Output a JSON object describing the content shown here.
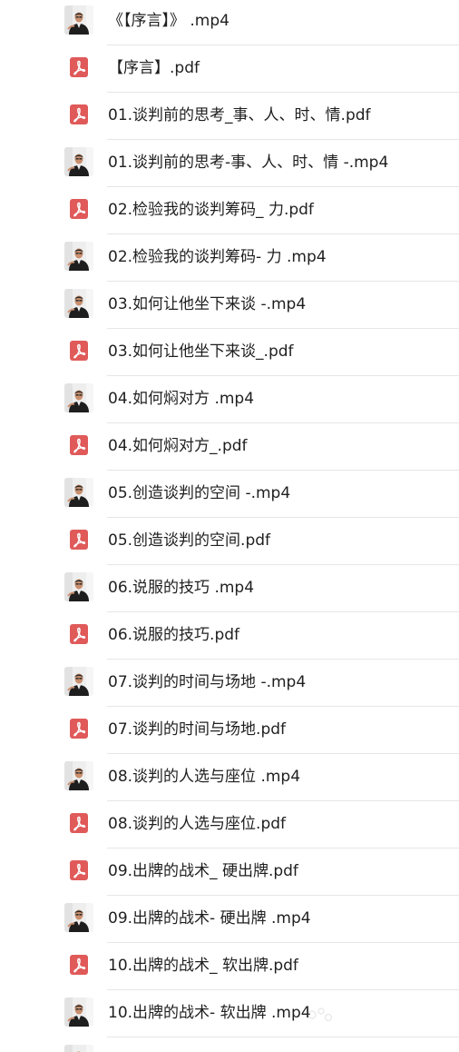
{
  "files": [
    {
      "name": "《【序言】》 .mp4",
      "type": "video",
      "icon": "video-thumbnail-icon"
    },
    {
      "name": "【序言】.pdf",
      "type": "pdf",
      "icon": "pdf-icon"
    },
    {
      "name": "01.谈判前的思考_事、人、时、情.pdf",
      "type": "pdf",
      "icon": "pdf-icon"
    },
    {
      "name": "01.谈判前的思考-事、人、时、情 -.mp4",
      "type": "video",
      "icon": "video-thumbnail-icon"
    },
    {
      "name": "02.检验我的谈判筹码_ 力.pdf",
      "type": "pdf",
      "icon": "pdf-icon"
    },
    {
      "name": "02.检验我的谈判筹码- 力 .mp4",
      "type": "video",
      "icon": "video-thumbnail-icon"
    },
    {
      "name": "03.如何让他坐下来谈 -.mp4",
      "type": "video",
      "icon": "video-thumbnail-icon"
    },
    {
      "name": "03.如何让他坐下来谈_.pdf",
      "type": "pdf",
      "icon": "pdf-icon"
    },
    {
      "name": "04.如何焖对方 .mp4",
      "type": "video",
      "icon": "video-thumbnail-icon"
    },
    {
      "name": "04.如何焖对方_.pdf",
      "type": "pdf",
      "icon": "pdf-icon"
    },
    {
      "name": "05.创造谈判的空间 -.mp4",
      "type": "video",
      "icon": "video-thumbnail-icon"
    },
    {
      "name": "05.创造谈判的空间.pdf",
      "type": "pdf",
      "icon": "pdf-icon"
    },
    {
      "name": "06.说服的技巧 .mp4",
      "type": "video",
      "icon": "video-thumbnail-icon"
    },
    {
      "name": "06.说服的技巧.pdf",
      "type": "pdf",
      "icon": "pdf-icon"
    },
    {
      "name": "07.谈判的时间与场地 -.mp4",
      "type": "video",
      "icon": "video-thumbnail-icon"
    },
    {
      "name": "07.谈判的时间与场地.pdf",
      "type": "pdf",
      "icon": "pdf-icon"
    },
    {
      "name": "08.谈判的人选与座位 .mp4",
      "type": "video",
      "icon": "video-thumbnail-icon"
    },
    {
      "name": "08.谈判的人选与座位.pdf",
      "type": "pdf",
      "icon": "pdf-icon"
    },
    {
      "name": "09.出牌的战术_ 硬出牌.pdf",
      "type": "pdf",
      "icon": "pdf-icon"
    },
    {
      "name": "09.出牌的战术- 硬出牌 .mp4",
      "type": "video",
      "icon": "video-thumbnail-icon"
    },
    {
      "name": "10.出牌的战术_ 软出牌.pdf",
      "type": "pdf",
      "icon": "pdf-icon"
    },
    {
      "name": "10.出牌的战术- 软出牌 .mp4",
      "type": "video",
      "icon": "video-thumbnail-icon"
    },
    {
      "name": "",
      "type": "video",
      "icon": "video-thumbnail-icon"
    }
  ],
  "colors": {
    "pdf_icon": "#e05a5a",
    "text": "#1f1f1f",
    "divider": "#e6e6e6"
  }
}
